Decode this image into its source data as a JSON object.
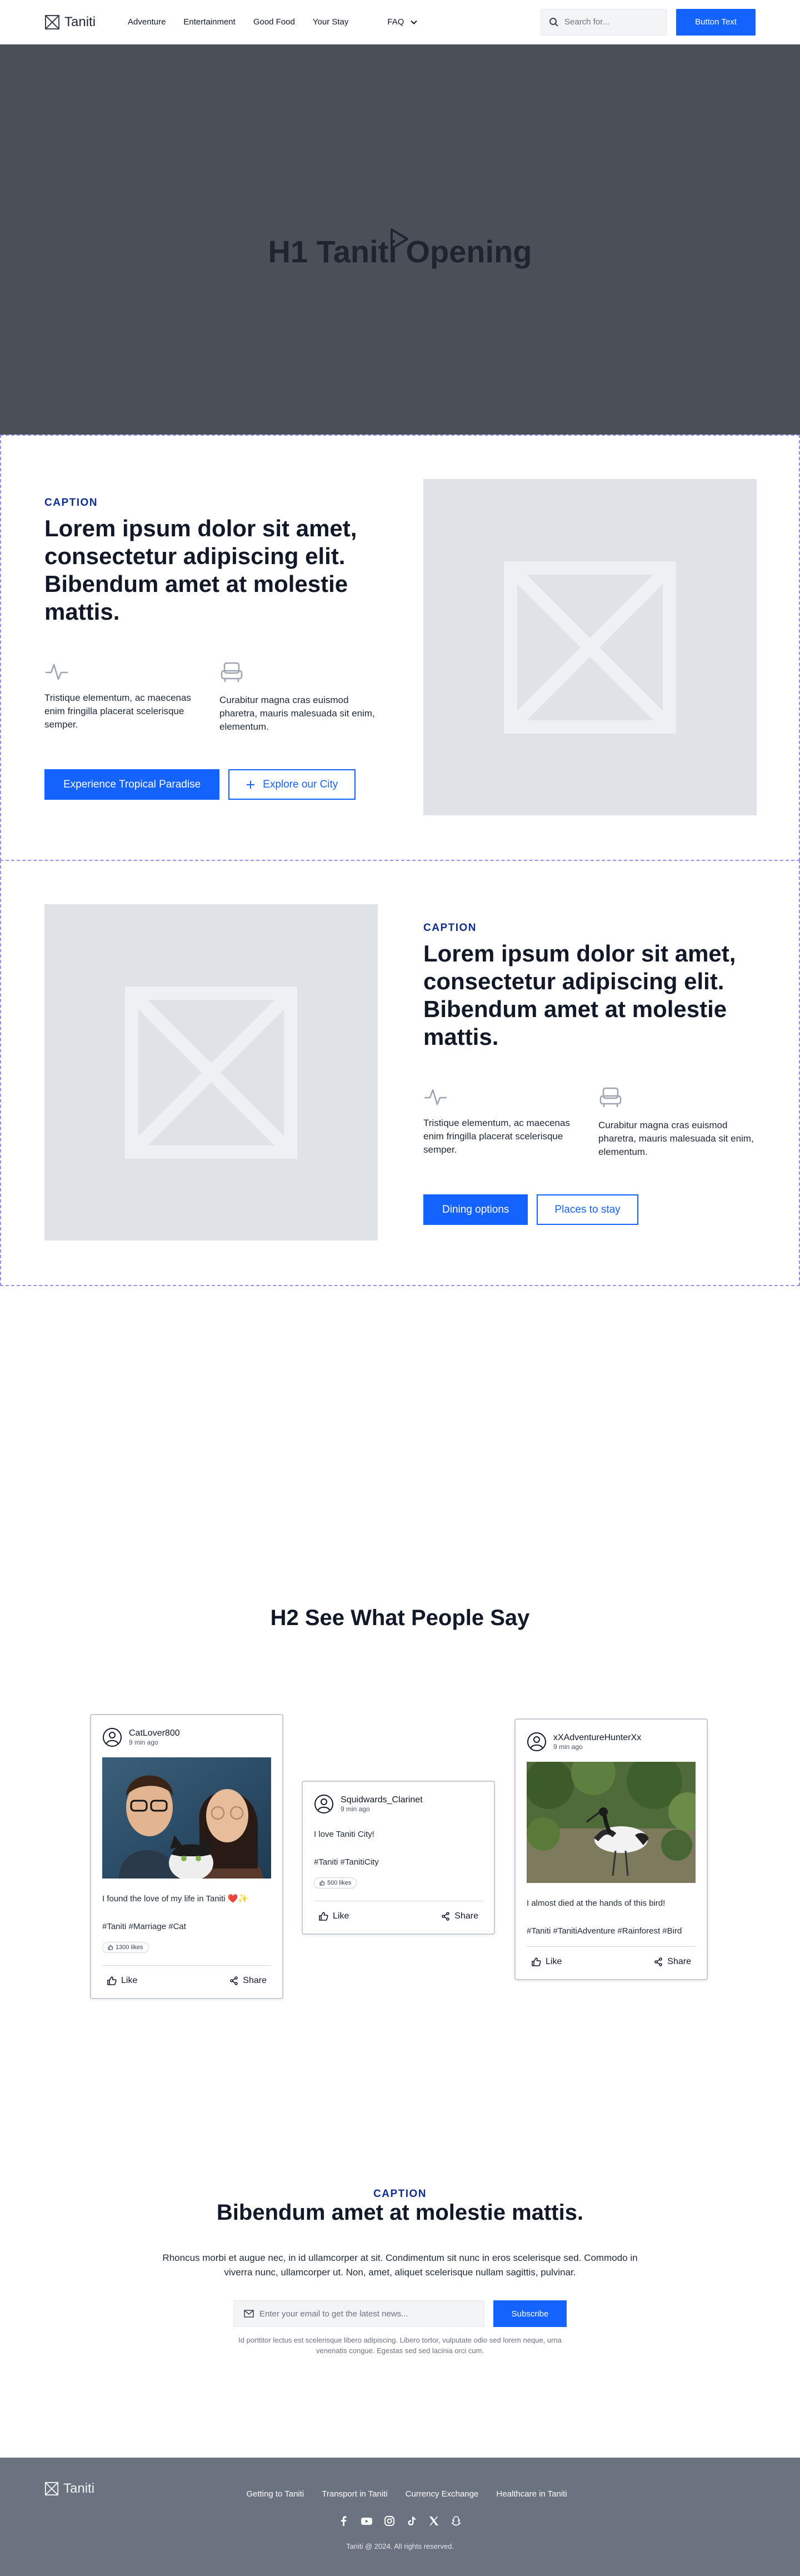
{
  "nav": {
    "brand": "Taniti",
    "links": [
      "Adventure",
      "Entertainment",
      "Good Food",
      "Your Stay"
    ],
    "faq": "FAQ",
    "search_placeholder": "Search for...",
    "button": "Button Text"
  },
  "hero": {
    "title": "H1 Taniti Opening"
  },
  "feature1": {
    "caption": "CAPTION",
    "title": "Lorem ipsum dolor sit amet, consectetur adipiscing elit. Bibendum amet at molestie mattis.",
    "col1": "Tristique elementum, ac maecenas enim fringilla placerat scelerisque semper.",
    "col2": "Curabitur magna cras euismod pharetra, mauris malesuada sit enim, elementum.",
    "btn_primary": "Experience Tropical Paradise",
    "btn_secondary": "Explore our City"
  },
  "feature2": {
    "caption": "CAPTION",
    "title": "Lorem ipsum dolor sit amet, consectetur adipiscing elit. Bibendum amet at molestie mattis.",
    "col1": "Tristique elementum, ac maecenas enim fringilla placerat scelerisque semper.",
    "col2": "Curabitur magna cras euismod pharetra, mauris malesuada sit enim, elementum.",
    "btn_primary": "Dining options",
    "btn_secondary": "Places to stay"
  },
  "testimonials": {
    "heading": "H2 See What People Say",
    "cards": [
      {
        "user": "CatLover800",
        "time": "9 min ago",
        "text": "I found the love of my life in Taniti ❤️✨",
        "tags": "#Taniti #Marriage #Cat",
        "likes": "1300 likes",
        "like": "Like",
        "share": "Share"
      },
      {
        "user": "Squidwards_Clarinet",
        "time": "9 min ago",
        "text": "I love Taniti City!",
        "tags": "#Taniti #TanitiCity",
        "likes": "500 likes",
        "like": "Like",
        "share": "Share"
      },
      {
        "user": "xXAdventureHunterXx",
        "time": "9 min ago",
        "text": "I almost died at the hands of this bird!",
        "tags": "#Taniti #TanitiAdventure #Rainforest #Bird",
        "like": "Like",
        "share": "Share"
      }
    ]
  },
  "newsletter": {
    "caption": "CAPTION",
    "title": "Bibendum amet at molestie mattis.",
    "description": "Rhoncus morbi et augue nec, in id ullamcorper at sit. Condimentum sit nunc in eros scelerisque sed. Commodo in viverra nunc, ullamcorper ut. Non, amet, aliquet scelerisque nullam sagittis, pulvinar.",
    "placeholder": "Enter your email to get the latest news...",
    "button": "Subscribe",
    "fine_print": "Id porttitor lectus est scelerisque libero adipiscing. Libero tortor, vulputate odio sed lorem neque, urna venenatis congue. Egestas sed sed lacinia orci cum."
  },
  "footer": {
    "brand": "Taniti",
    "links": [
      "Getting to Taniti",
      "Transport in Taniti",
      "Currency Exchange",
      "Healthcare in Taniti"
    ],
    "social_icons": [
      "facebook-icon",
      "youtube-icon",
      "instagram-icon",
      "tiktok-icon",
      "x-icon",
      "snapchat-icon"
    ],
    "copyright": "Taniti @ 2024. All rights reserved."
  },
  "colors": {
    "primary": "#1563ff",
    "caption": "#0f2d8f",
    "hero_bg": "#4b5058",
    "footer_bg": "#6b7280",
    "placeholder_bg": "#dfe2e7"
  }
}
